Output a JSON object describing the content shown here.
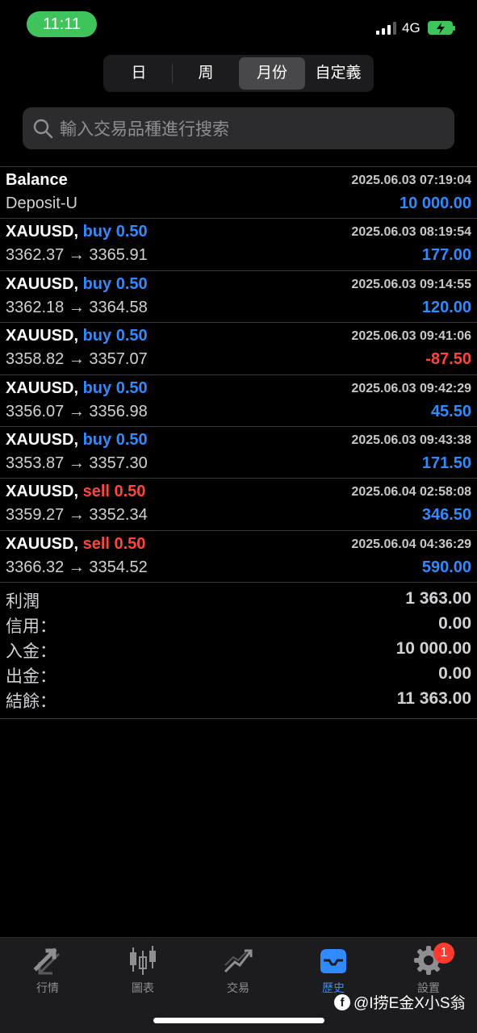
{
  "status_bar": {
    "time": "11:11",
    "network": "4G"
  },
  "period_tabs": [
    {
      "label": "日",
      "active": false
    },
    {
      "label": "周",
      "active": false
    },
    {
      "label": "月份",
      "active": true
    },
    {
      "label": "自定義",
      "active": false
    }
  ],
  "search": {
    "placeholder": "輸入交易品種進行搜索"
  },
  "entries": [
    {
      "symbol": "Balance",
      "side": "",
      "volume": "",
      "date": "2025.06.03 07:19:04",
      "prices": "Deposit-U",
      "amount": "10 000.00",
      "negative": false
    },
    {
      "symbol": "XAUUSD,",
      "side": "buy",
      "volume": "0.50",
      "date": "2025.06.03 08:19:54",
      "prices": "3362.37 → 3365.91",
      "amount": "177.00",
      "negative": false
    },
    {
      "symbol": "XAUUSD,",
      "side": "buy",
      "volume": "0.50",
      "date": "2025.06.03 09:14:55",
      "prices": "3362.18 → 3364.58",
      "amount": "120.00",
      "negative": false
    },
    {
      "symbol": "XAUUSD,",
      "side": "buy",
      "volume": "0.50",
      "date": "2025.06.03 09:41:06",
      "prices": "3358.82 → 3357.07",
      "amount": "-87.50",
      "negative": true
    },
    {
      "symbol": "XAUUSD,",
      "side": "buy",
      "volume": "0.50",
      "date": "2025.06.03 09:42:29",
      "prices": "3356.07 → 3356.98",
      "amount": "45.50",
      "negative": false
    },
    {
      "symbol": "XAUUSD,",
      "side": "buy",
      "volume": "0.50",
      "date": "2025.06.03 09:43:38",
      "prices": "3353.87 → 3357.30",
      "amount": "171.50",
      "negative": false
    },
    {
      "symbol": "XAUUSD,",
      "side": "sell",
      "volume": "0.50",
      "date": "2025.06.04 02:58:08",
      "prices": "3359.27 → 3352.34",
      "amount": "346.50",
      "negative": false
    },
    {
      "symbol": "XAUUSD,",
      "side": "sell",
      "volume": "0.50",
      "date": "2025.06.04 04:36:29",
      "prices": "3366.32 → 3354.52",
      "amount": "590.00",
      "negative": false
    }
  ],
  "summary": [
    {
      "key": "利潤",
      "value": "1 363.00"
    },
    {
      "key": "信用：",
      "value": "0.00"
    },
    {
      "key": "入金：",
      "value": "10 000.00"
    },
    {
      "key": "出金：",
      "value": "0.00"
    },
    {
      "key": "結餘：",
      "value": "11 363.00"
    }
  ],
  "tab_bar": {
    "items": [
      {
        "label": "行情",
        "icon": "quotes-arrows-icon",
        "active": false
      },
      {
        "label": "圖表",
        "icon": "candlestick-chart-icon",
        "active": false
      },
      {
        "label": "交易",
        "icon": "trade-trend-icon",
        "active": false
      },
      {
        "label": "歷史",
        "icon": "history-tray-icon",
        "active": true
      },
      {
        "label": "設置",
        "icon": "gear-icon",
        "active": false,
        "badge": "1"
      }
    ]
  },
  "watermark": {
    "text": "@I捞E金X小S翁"
  },
  "colors": {
    "buy": "#2f8bff",
    "sell": "#ff453a",
    "active_tab": "#2f8bff",
    "time_pill": "#3ec45a"
  }
}
